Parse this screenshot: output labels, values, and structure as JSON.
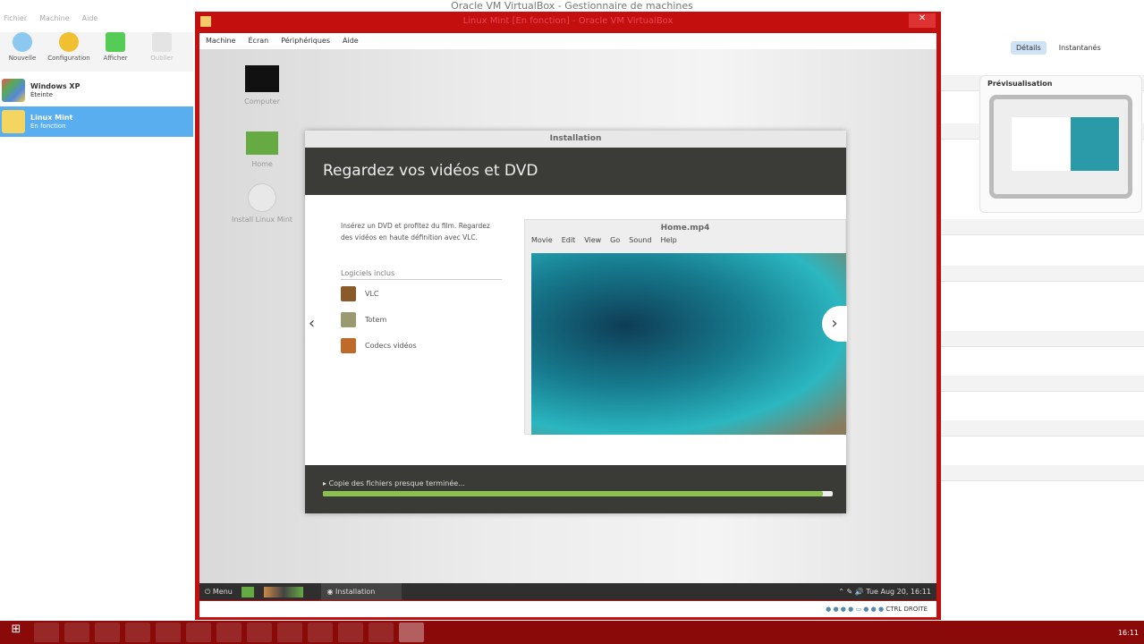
{
  "manager": {
    "title": "Oracle VM VirtualBox - Gestionnaire de machines",
    "menu": [
      "Fichier",
      "Machine",
      "Aide"
    ],
    "toolbar": [
      "Nouvelle",
      "Configuration",
      "Afficher",
      "Oublier"
    ],
    "vms": [
      {
        "name": "Windows XP",
        "state": "Éteinte"
      },
      {
        "name": "Linux Mint",
        "state": "En fonction"
      }
    ],
    "details_label": "Détails",
    "snapshots_label": "Instantanés",
    "preview_label": "Prévisualisation"
  },
  "vmwindow": {
    "title": "Linux Mint [En fonction] - Oracle VM VirtualBox",
    "menu": [
      "Machine",
      "Écran",
      "Périphériques",
      "Aide"
    ],
    "desktop_icons": [
      "Computer",
      "Home",
      "Install Linux Mint"
    ]
  },
  "installer": {
    "title": "Installation",
    "heading": "Regardez vos vidéos et DVD",
    "description": "Insérez un DVD et profitez du film. Regardez des vidéos en haute définition avec VLC.",
    "software_heading": "Logiciels inclus",
    "software": [
      "VLC",
      "Totem",
      "Codecs vidéos"
    ],
    "video_title": "Home.mp4",
    "video_menu": [
      "Movie",
      "Edit",
      "View",
      "Go",
      "Sound",
      "Help"
    ],
    "progress_text": "Copie des fichiers presque terminée...",
    "progress": 0.98
  },
  "guest_panel": {
    "menu_label": "Menu",
    "task": "Installation",
    "clock": "Tue Aug 20, 16:11"
  },
  "status_bar": {
    "host_key": "CTRL DROITE"
  },
  "taskbar": {
    "clock": "16:11"
  },
  "colors": {
    "frame": "#c40f0f",
    "taskbar": "#8a0a0a",
    "progress": "#8cc152"
  }
}
